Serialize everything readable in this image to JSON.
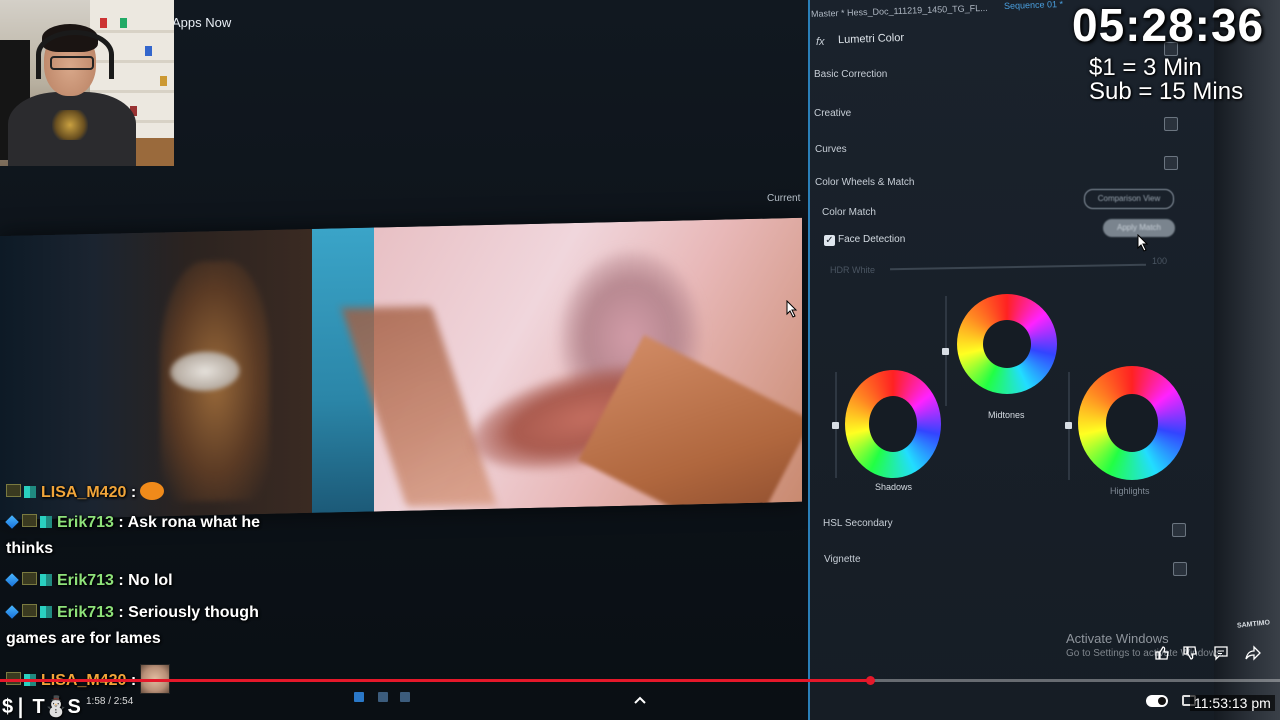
{
  "stream_overlay": {
    "timer": "05:28:36",
    "rate_line_1": "$1 = 3 Min",
    "rate_line_2": "Sub = 15 Mins"
  },
  "editor": {
    "tab_partial_label": "Apps Now",
    "current_label": "Current"
  },
  "lumetri": {
    "sequence_header": "Master * Hess_Doc_111219_1450_TG_FL...",
    "sequence_tab": "Sequence 01 *",
    "fx_label": "fx",
    "title": "Lumetri Color",
    "sections": {
      "basic_correction": "Basic Correction",
      "creative": "Creative",
      "curves": "Curves",
      "color_wheels_match": "Color Wheels & Match",
      "color_match": "Color Match",
      "hsl_secondary": "HSL Secondary",
      "vignette": "Vignette"
    },
    "face_detection_label": "Face Detection",
    "face_detection_checked": true,
    "hdr_white_label": "HDR White",
    "hdr_white_value": "100",
    "comparison_view_label": "Comparison View",
    "apply_match_label": "Apply Match",
    "wheels": {
      "midtones": "Midtones",
      "shadows": "Shadows",
      "highlights": "Highlights"
    }
  },
  "chat": [
    {
      "user": "LISA_M420",
      "separator": ":",
      "text": "",
      "emote": "pumpkin",
      "user_color": "#f1a53a"
    },
    {
      "user": "Erik713",
      "separator": ":",
      "text": "Ask rona what he",
      "continuation": "thinks",
      "user_color": "#8ee27a"
    },
    {
      "user": "Erik713",
      "separator": ":",
      "text": "No lol",
      "user_color": "#8ee27a"
    },
    {
      "user": "Erik713",
      "separator": ":",
      "text": "Seriously though",
      "continuation": "games are for lames",
      "user_color": "#8ee27a"
    },
    {
      "user": "LISA_M420",
      "separator": ":",
      "text": "",
      "emote": "face",
      "user_color": "#f1a53a"
    }
  ],
  "player": {
    "logo_text": "$❘ T⛄S",
    "time": "1:58 / 2:54",
    "progress_fraction": 0.68,
    "clock": "11:53:13 pm",
    "watermark": "SAMTIMO"
  },
  "windows": {
    "activate_title": "Activate Windows",
    "activate_sub": "Go to Settings to activate Windows."
  },
  "colors": {
    "progress": "#e5182a",
    "panel_border": "#2a7fb8",
    "erik": "#8ee27a",
    "lisa": "#f1a53a"
  }
}
